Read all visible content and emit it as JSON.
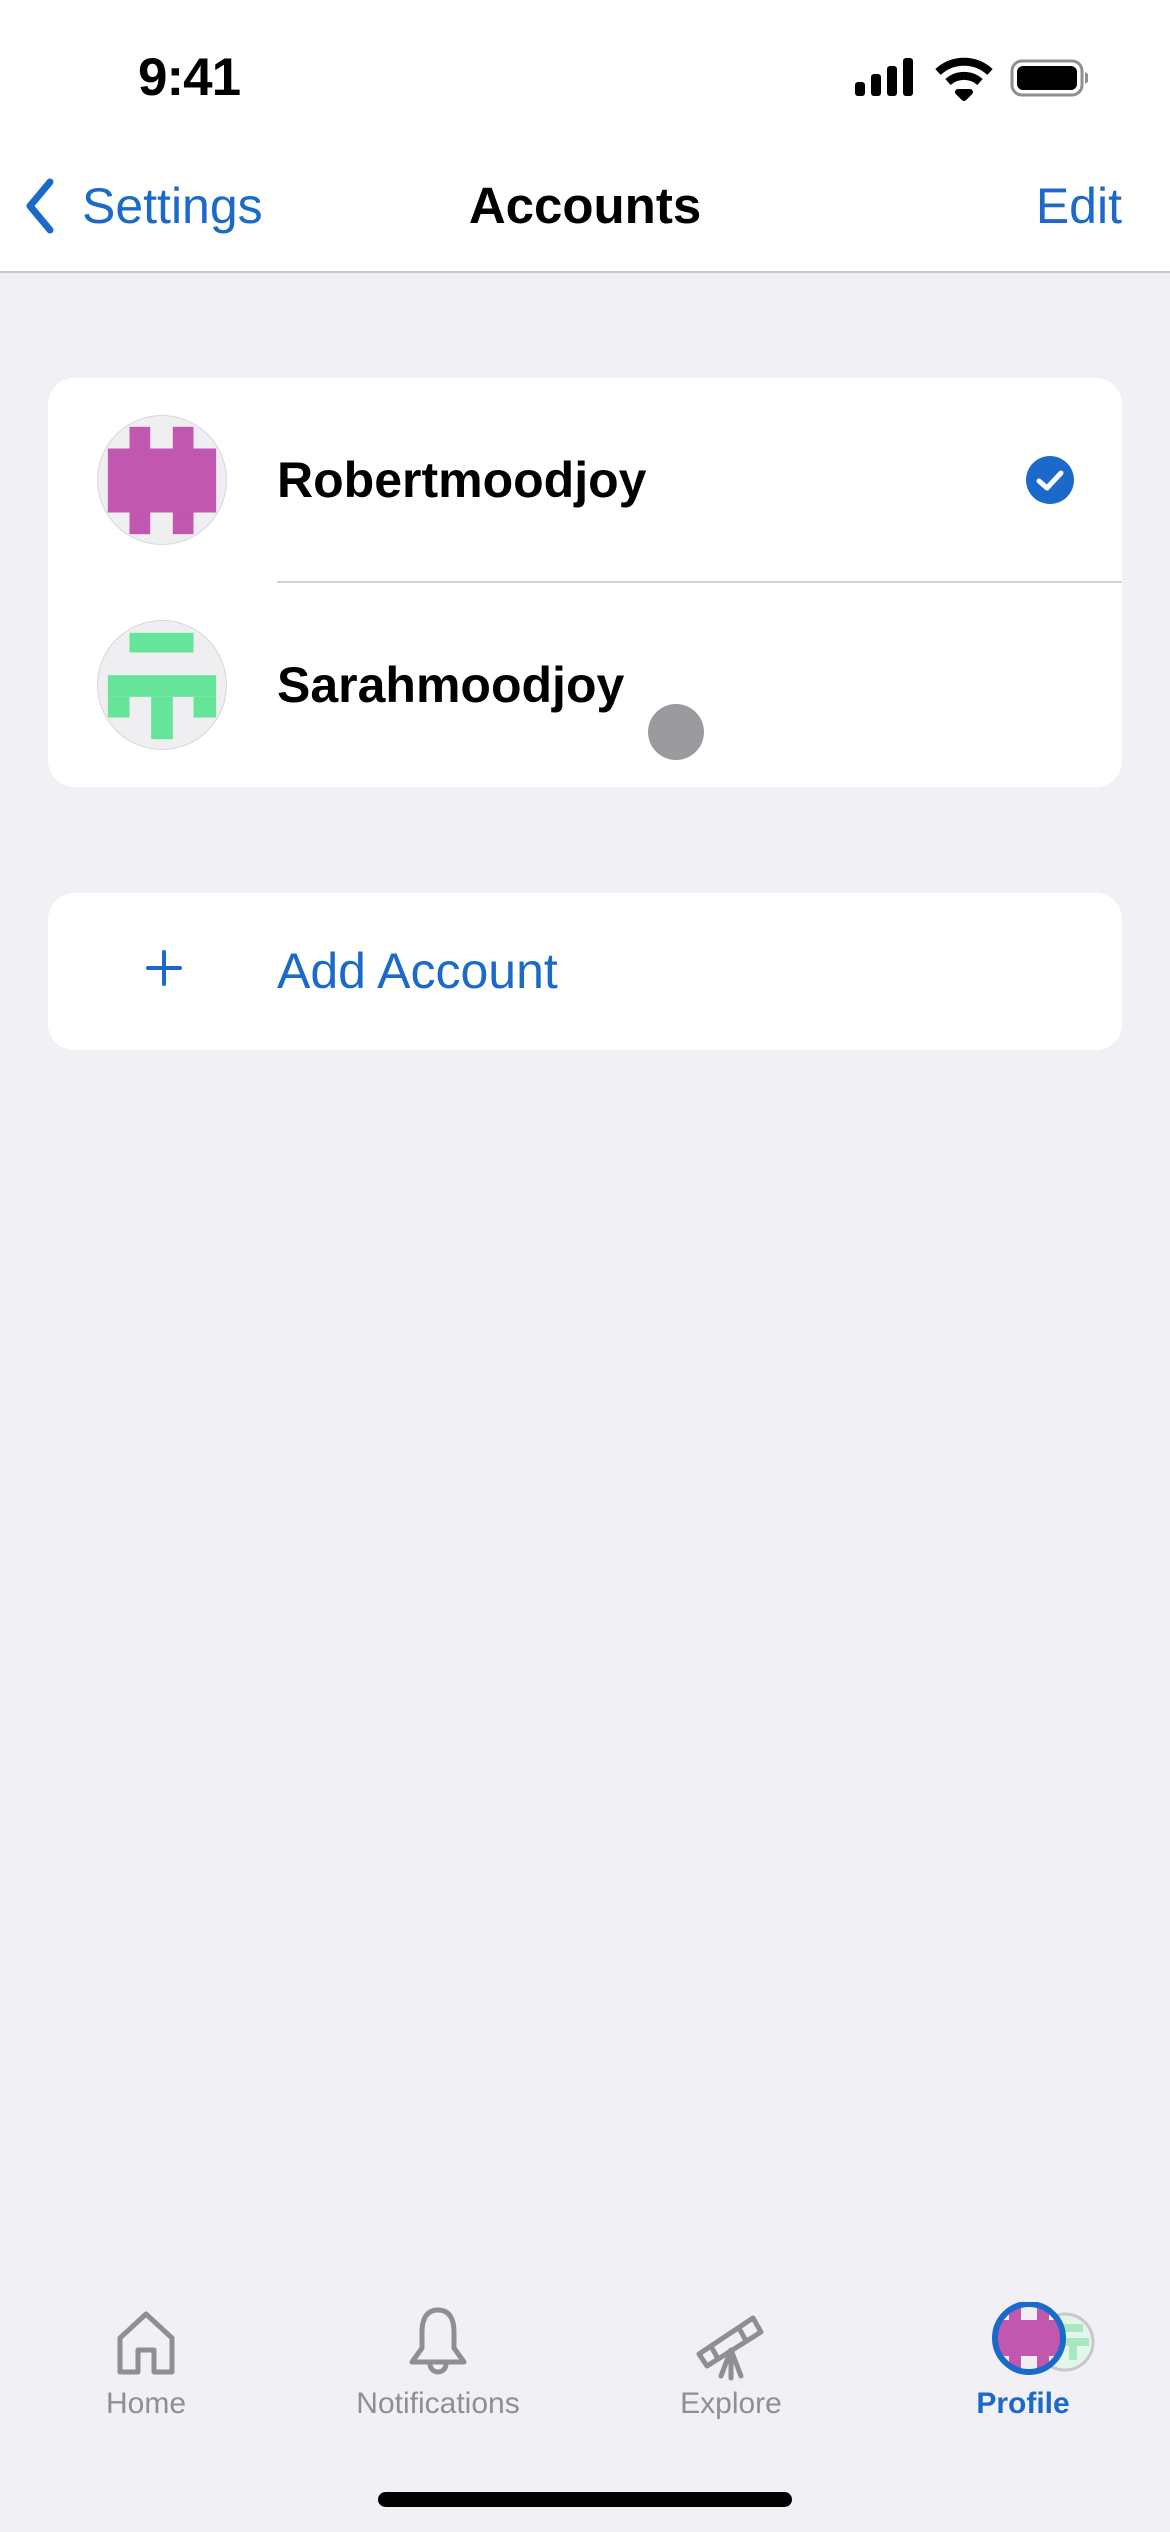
{
  "status_bar": {
    "time": "9:41",
    "icons": [
      "cellular-signal-icon",
      "wifi-icon",
      "battery-icon"
    ]
  },
  "nav": {
    "back_label": "Settings",
    "back_icon": "chevron-left-icon",
    "title": "Accounts",
    "edit_label": "Edit"
  },
  "accounts": [
    {
      "name": "Robertmoodjoy",
      "avatar_color": "#C157AE",
      "avatar_style": "pixel-purple",
      "selected": true,
      "selected_icon": "checkmark-circle-icon"
    },
    {
      "name": "Sarahmoodjoy",
      "avatar_color": "#66E59A",
      "avatar_style": "pixel-green",
      "selected": false
    }
  ],
  "add_account": {
    "icon": "plus-icon",
    "label": "Add Account"
  },
  "tabbar": {
    "active": "Profile",
    "tabs": [
      {
        "label": "Home",
        "icon": "house-icon"
      },
      {
        "label": "Notifications",
        "icon": "bell-icon"
      },
      {
        "label": "Explore",
        "icon": "telescope-icon"
      },
      {
        "label": "Profile",
        "icon": "profile-avatar-icon"
      }
    ]
  },
  "colors": {
    "accent": "#1B6AC9",
    "background": "#F0F0F5",
    "card": "#FFFFFF",
    "inactive_tab": "#8E8E93"
  }
}
